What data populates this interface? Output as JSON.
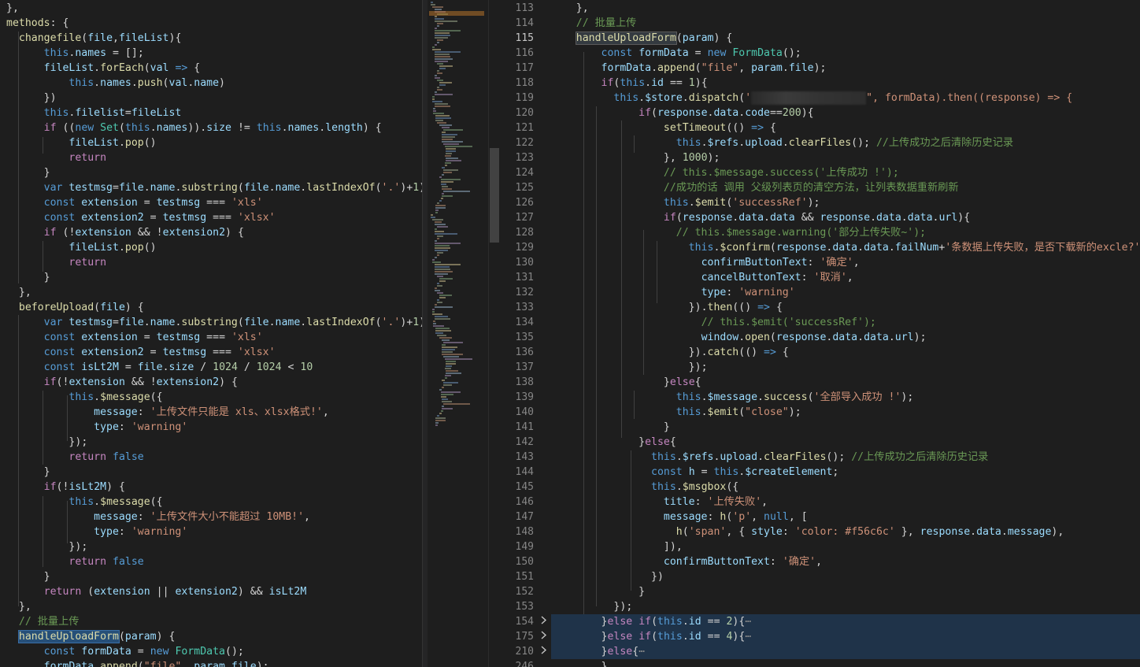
{
  "left_code": [
    "},",
    "methods: {",
    "  changefile(file,fileList){",
    "      this.names = [];",
    "      fileList.forEach(val => {",
    "          this.names.push(val.name)",
    "      })",
    "      this.filelist=fileList",
    "      if ((new Set(this.names)).size != this.names.length) {",
    "          fileList.pop()",
    "          return",
    "      }",
    "      var testmsg=file.name.substring(file.name.lastIndexOf('.')+1)",
    "      const extension = testmsg === 'xls'",
    "      const extension2 = testmsg === 'xlsx'",
    "      if (!extension && !extension2) {",
    "          fileList.pop()",
    "          return",
    "      }",
    "  },",
    "  beforeUpload(file) {",
    "      var testmsg=file.name.substring(file.name.lastIndexOf('.')+1)",
    "      const extension = testmsg === 'xls'",
    "      const extension2 = testmsg === 'xlsx'",
    "      const isLt2M = file.size / 1024 / 1024 < 10",
    "      if(!extension && !extension2) {",
    "          this.$message({",
    "              message: '上传文件只能是 xls、xlsx格式!',",
    "              type: 'warning'",
    "          });",
    "          return false",
    "      }",
    "      if(!isLt2M) {",
    "          this.$message({",
    "              message: '上传文件大小不能超过 10MB!',",
    "              type: 'warning'",
    "          });",
    "          return false",
    "      }",
    "      return (extension || extension2) && isLt2M",
    "  },",
    "  // 批量上传",
    "  handleUploadForm(param) {",
    "      const formData = new FormData();",
    "      formData.append(\"file\", param.file);"
  ],
  "right_code": [
    {
      "n": "113",
      "t": "    },"
    },
    {
      "n": "114",
      "t": "    // 批量上传"
    },
    {
      "n": "115",
      "t": "    handleUploadForm(param) {"
    },
    {
      "n": "116",
      "t": "        const formData = new FormData();"
    },
    {
      "n": "117",
      "t": "        formData.append(\"file\", param.file);"
    },
    {
      "n": "118",
      "t": "        if(this.id == 1){"
    },
    {
      "n": "119",
      "t": "          this.$store.dispatch('",
      "redacted": true,
      "t2": "\", formData).then((response) => {"
    },
    {
      "n": "120",
      "t": "              if(response.data.code==200){"
    },
    {
      "n": "121",
      "t": "                  setTimeout(() => {"
    },
    {
      "n": "122",
      "t": "                    this.$refs.upload.clearFiles(); //上传成功之后清除历史记录"
    },
    {
      "n": "123",
      "t": "                  }, 1000);"
    },
    {
      "n": "124",
      "t": "                  // this.$message.success('上传成功 !');"
    },
    {
      "n": "125",
      "t": "                  //成功的话 调用 父级列表页的清空方法，让列表数据重新刷新"
    },
    {
      "n": "126",
      "t": "                  this.$emit('successRef');"
    },
    {
      "n": "127",
      "t": "                  if(response.data.data && response.data.data.url){"
    },
    {
      "n": "128",
      "t": "                    // this.$message.warning('部分上传失败~');"
    },
    {
      "n": "129",
      "t": "                      this.$confirm(response.data.data.failNum+'条数据上传失败，是否下载新的excle?',"
    },
    {
      "n": "130",
      "t": "                        confirmButtonText: '确定',"
    },
    {
      "n": "131",
      "t": "                        cancelButtonText: '取消',"
    },
    {
      "n": "132",
      "t": "                        type: 'warning'"
    },
    {
      "n": "133",
      "t": "                      }).then(() => {"
    },
    {
      "n": "134",
      "t": "                        // this.$emit('successRef');"
    },
    {
      "n": "135",
      "t": "                        window.open(response.data.data.url);"
    },
    {
      "n": "136",
      "t": "                      }).catch(() => {"
    },
    {
      "n": "137",
      "t": "                      });"
    },
    {
      "n": "138",
      "t": "                  }else{"
    },
    {
      "n": "139",
      "t": "                    this.$message.success('全部导入成功 !');"
    },
    {
      "n": "140",
      "t": "                    this.$emit(\"close\");"
    },
    {
      "n": "141",
      "t": "                  }"
    },
    {
      "n": "142",
      "t": "              }else{"
    },
    {
      "n": "143",
      "t": "                this.$refs.upload.clearFiles(); //上传成功之后清除历史记录"
    },
    {
      "n": "144",
      "t": "                const h = this.$createElement;"
    },
    {
      "n": "145",
      "t": "                this.$msgbox({"
    },
    {
      "n": "146",
      "t": "                  title: '上传失败',"
    },
    {
      "n": "147",
      "t": "                  message: h('p', null, ["
    },
    {
      "n": "148",
      "t": "                    h('span', { style: 'color: #f56c6c' }, response.data.message),"
    },
    {
      "n": "149",
      "t": "                  ]),"
    },
    {
      "n": "150",
      "t": "                  confirmButtonText: '确定',"
    },
    {
      "n": "151",
      "t": "                })"
    },
    {
      "n": "152",
      "t": "              }"
    },
    {
      "n": "153",
      "t": "          });"
    },
    {
      "n": "154",
      "t": "        }else if(this.id == 2){",
      "folded": true
    },
    {
      "n": "175",
      "t": "        }else if(this.id == 4){",
      "folded": true
    },
    {
      "n": "210",
      "t": "        }else{",
      "folded": true
    },
    {
      "n": "246",
      "t": "        }"
    }
  ],
  "ellipsis": "⋯",
  "fold_icon": "chevron-right-icon",
  "colors": {
    "background": "#1e1e1e",
    "keyword": "#569cd6",
    "control": "#c586c0",
    "function": "#dcdcaa",
    "string": "#ce9178",
    "number": "#b5cea8",
    "comment": "#6a9955",
    "property": "#9cdcfe",
    "class": "#4ec9b0"
  }
}
